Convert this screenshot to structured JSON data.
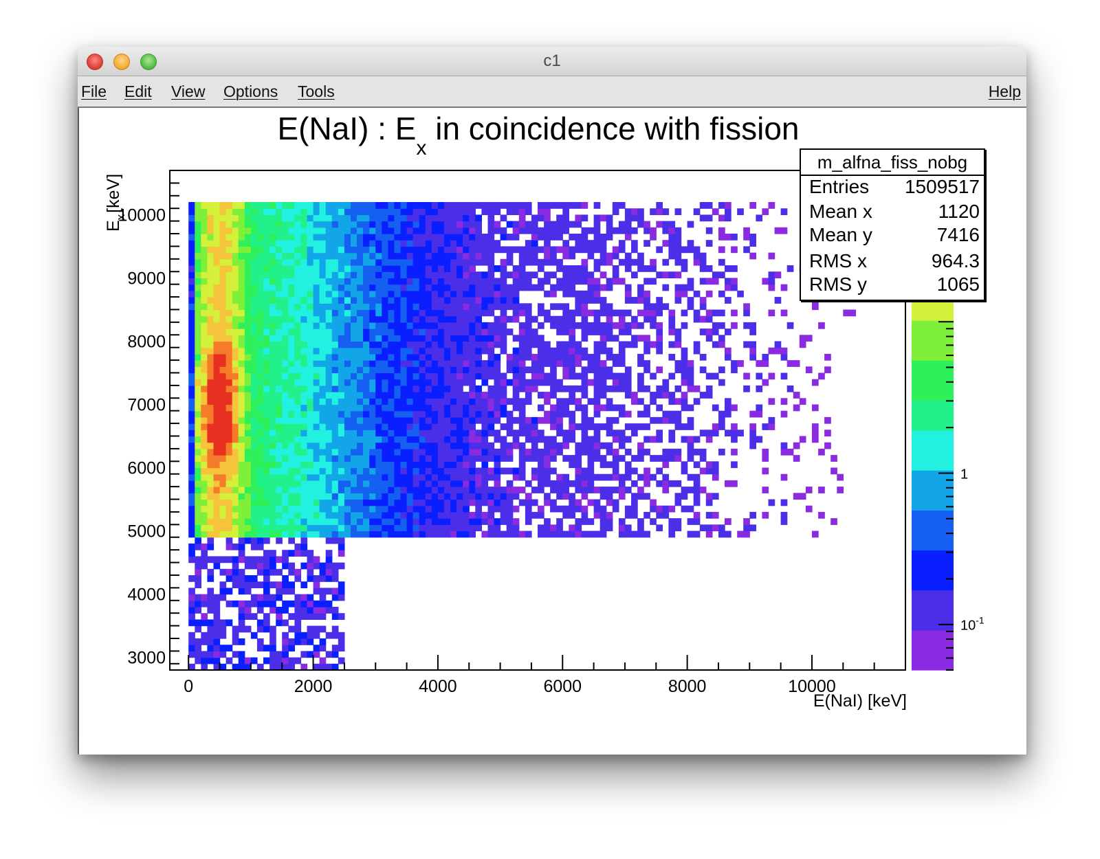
{
  "window": {
    "title": "c1",
    "controls": [
      "close",
      "minimize",
      "zoom"
    ]
  },
  "menu": {
    "items": [
      "File",
      "Edit",
      "View",
      "Options",
      "Tools"
    ],
    "help": "Help"
  },
  "colors": {
    "palette": [
      "#8a2be2",
      "#4b2fe8",
      "#0a1fff",
      "#1560f0",
      "#12a6e8",
      "#22f0e0",
      "#22f08a",
      "#2df05a",
      "#7ff03a",
      "#d4f03a",
      "#f5c43a",
      "#f57a2a",
      "#e83020"
    ]
  },
  "chart_data": {
    "type": "heatmap",
    "title_main": "E(NaI) : E",
    "title_sub": "x",
    "title_rest": " in coincidence with fission",
    "xlabel": "E(NaI) [keV]",
    "ylabel_main": "E",
    "ylabel_sub": "x",
    "ylabel_rest": "[keV]",
    "xlim": [
      -300,
      11500
    ],
    "ylim": [
      2800,
      10700
    ],
    "x_ticks": [
      0,
      2000,
      4000,
      6000,
      8000,
      10000
    ],
    "y_ticks": [
      3000,
      4000,
      5000,
      6000,
      7000,
      8000,
      9000,
      10000
    ],
    "z_scale": "log",
    "z_ticks": [
      {
        "label": "1",
        "exp": "",
        "value": 1
      },
      {
        "label": "10",
        "exp": "-1",
        "value": 0.1
      }
    ],
    "z_range": [
      0.05,
      100
    ],
    "stats": {
      "name": "m_alfna_fiss_nobg",
      "rows": [
        {
          "label": "Entries",
          "value": "1509517"
        },
        {
          "label": "Mean x",
          "value": "1120"
        },
        {
          "label": "Mean y",
          "value": "7416"
        },
        {
          "label": "RMS x",
          "value": "964.3"
        },
        {
          "label": "RMS y",
          "value": "1065"
        }
      ]
    }
  }
}
